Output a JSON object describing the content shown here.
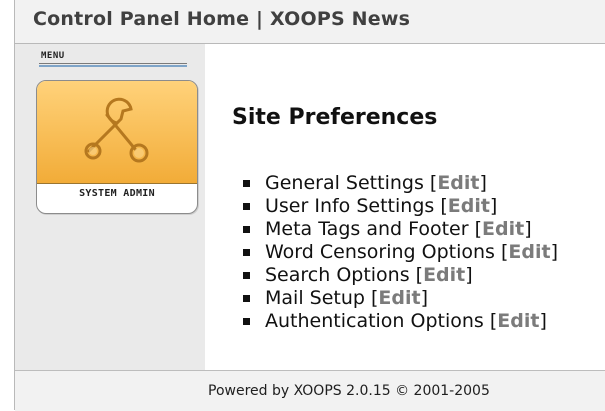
{
  "header": {
    "link_home": "Control Panel Home",
    "separator": " | ",
    "link_module": "XOOPS News"
  },
  "sidebar": {
    "menu_label": "MENU",
    "system_admin_label": "SYSTEM ADMIN",
    "system_admin_icon": "tools-icon"
  },
  "main": {
    "title": "Site Preferences",
    "edit_label": "Edit",
    "items": [
      {
        "label": "General Settings"
      },
      {
        "label": "User Info Settings"
      },
      {
        "label": "Meta Tags and Footer"
      },
      {
        "label": "Word Censoring Options"
      },
      {
        "label": "Search Options"
      },
      {
        "label": "Mail Setup"
      },
      {
        "label": "Authentication Options"
      }
    ]
  },
  "footer": {
    "text": "Powered by XOOPS 2.0.15 © 2001-2005"
  },
  "colors": {
    "card_top": "#f2ac38",
    "edit_link": "#7b7b7b",
    "menu_rule": "#7ea4c8"
  }
}
